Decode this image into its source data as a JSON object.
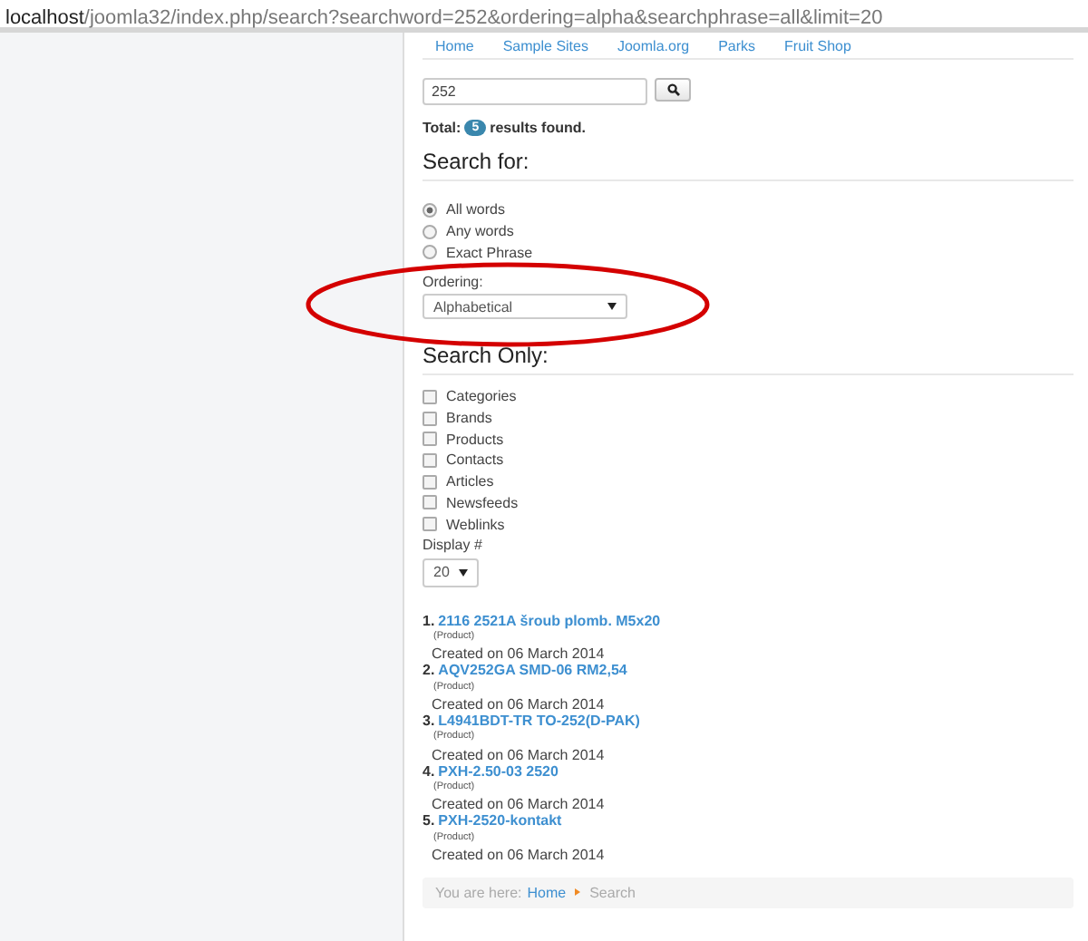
{
  "address_bar": {
    "host": "localhost",
    "path": "/joomla32/index.php/search?searchword=252&ordering=alpha&searchphrase=all&limit=20"
  },
  "nav": [
    "Home",
    "Sample Sites",
    "Joomla.org",
    "Parks",
    "Fruit Shop"
  ],
  "search": {
    "value": "252"
  },
  "total": {
    "label": "Total:",
    "count": "5",
    "suffix": "results found."
  },
  "search_for": {
    "heading": "Search for:",
    "options": [
      {
        "label": "All words",
        "selected": true
      },
      {
        "label": "Any words",
        "selected": false
      },
      {
        "label": "Exact Phrase",
        "selected": false
      }
    ]
  },
  "ordering": {
    "label": "Ordering:",
    "value": "Alphabetical"
  },
  "search_only": {
    "heading": "Search Only:",
    "options": [
      {
        "label": "Categories",
        "checked": false
      },
      {
        "label": "Brands",
        "checked": false
      },
      {
        "label": "Products",
        "checked": false
      },
      {
        "label": "Contacts",
        "checked": false
      },
      {
        "label": "Articles",
        "checked": false
      },
      {
        "label": "Newsfeeds",
        "checked": false
      },
      {
        "label": "Weblinks",
        "checked": false
      }
    ]
  },
  "display": {
    "label": "Display #",
    "value": "20"
  },
  "results": [
    {
      "number": "1.",
      "title": "2116 2521A šroub plomb. M5x20",
      "type": "(Product)",
      "created": "Created on 06 March 2014"
    },
    {
      "number": "2.",
      "title": "AQV252GA SMD-06 RM2,54",
      "type": "(Product)",
      "created": "Created on 06 March 2014"
    },
    {
      "number": "3.",
      "title": "L4941BDT-TR TO-252(D-PAK)",
      "type": "(Product)",
      "created": "Created on 06 March 2014"
    },
    {
      "number": "4.",
      "title": "PXH-2.50-03 2520",
      "type": "(Product)",
      "created": "Created on 06 March 2014"
    },
    {
      "number": "5.",
      "title": "PXH-2520-kontakt",
      "type": "(Product)",
      "created": "Created on 06 March 2014"
    }
  ],
  "breadcrumb": {
    "prefix": "You are here:",
    "items": [
      "Home",
      "Search"
    ]
  }
}
